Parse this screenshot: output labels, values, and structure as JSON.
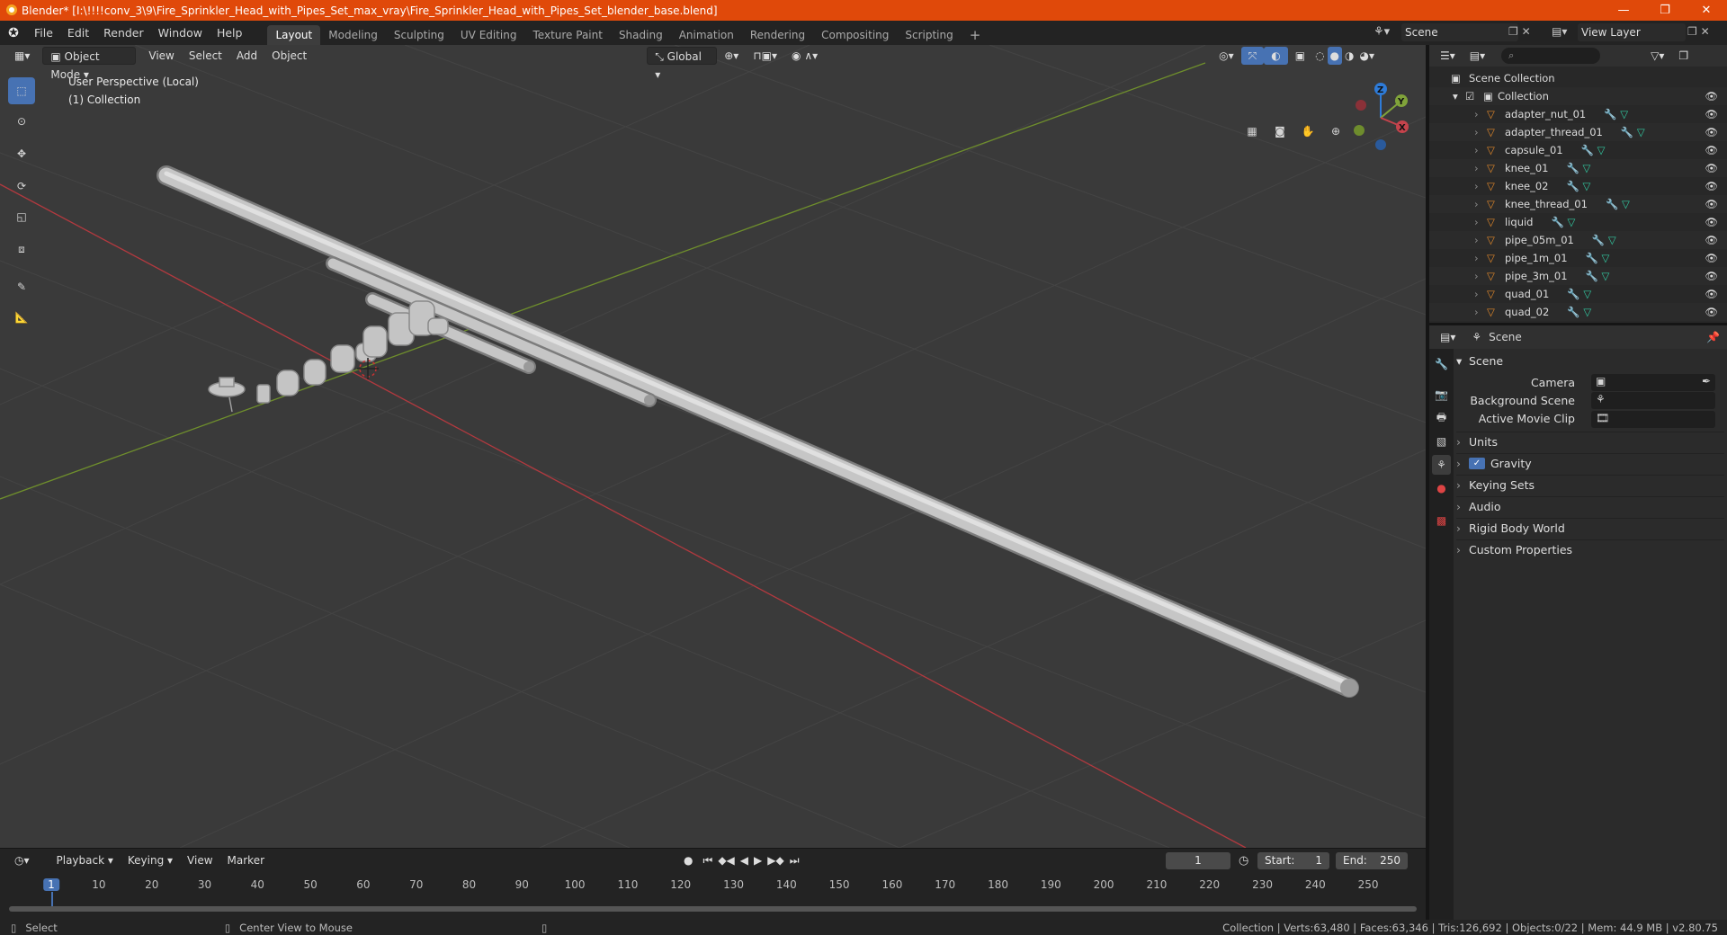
{
  "titlebar": {
    "title": "Blender* [I:\\!!!!conv_3\\9\\Fire_Sprinkler_Head_with_Pipes_Set_max_vray\\Fire_Sprinkler_Head_with_Pipes_Set_blender_base.blend]",
    "minimize": "—",
    "maximize": "❐",
    "close": "✕"
  },
  "menu": [
    "File",
    "Edit",
    "Render",
    "Window",
    "Help"
  ],
  "workspaces": [
    "Layout",
    "Modeling",
    "Sculpting",
    "UV Editing",
    "Texture Paint",
    "Shading",
    "Animation",
    "Rendering",
    "Compositing",
    "Scripting"
  ],
  "workspace_add": "+",
  "scene_name": "Scene",
  "view_layer": "View Layer",
  "viewport": {
    "mode": "Object Mode",
    "menus": [
      "View",
      "Select",
      "Add",
      "Object"
    ],
    "orientation": "Global",
    "perspective_label": "User Perspective (Local)",
    "collection_label": "(1) Collection",
    "gizmo": {
      "x": "X",
      "y": "Y",
      "z": "Z"
    }
  },
  "timeline": {
    "menus": [
      "Playback",
      "Keying",
      "View",
      "Marker"
    ],
    "current_frame": "1",
    "start_label": "Start:",
    "start": "1",
    "end_label": "End:",
    "end": "250",
    "ruler": [
      "1",
      "10",
      "20",
      "30",
      "40",
      "50",
      "60",
      "70",
      "80",
      "90",
      "100",
      "110",
      "120",
      "130",
      "140",
      "150",
      "160",
      "170",
      "180",
      "190",
      "200",
      "210",
      "220",
      "230",
      "240",
      "250"
    ]
  },
  "statusbar": {
    "select": "Select",
    "center": "Center View to Mouse",
    "stats": "Collection | Verts:63,480 | Faces:63,346 | Tris:126,692 | Objects:0/22 | Mem: 44.9 MB | v2.80.75"
  },
  "outliner": {
    "root": "Scene Collection",
    "collection": "Collection",
    "items": [
      "adapter_nut_01",
      "adapter_thread_01",
      "capsule_01",
      "knee_01",
      "knee_02",
      "knee_thread_01",
      "liquid",
      "pipe_05m_01",
      "pipe_1m_01",
      "pipe_3m_01",
      "quad_01",
      "quad_02"
    ]
  },
  "properties": {
    "context": "Scene",
    "panel_title": "Scene",
    "camera_label": "Camera",
    "background_scene_label": "Background Scene",
    "active_movie_clip_label": "Active Movie Clip",
    "subpanels": [
      "Units",
      "Gravity",
      "Keying Sets",
      "Audio",
      "Rigid Body World",
      "Custom Properties"
    ]
  },
  "colors": {
    "accent": "#4772b3",
    "titlebar": "#e0490a",
    "x_axis": "#c5434c",
    "y_axis": "#80a33a",
    "z_axis": "#2e7bd8",
    "object_orange": "#e0872a"
  }
}
